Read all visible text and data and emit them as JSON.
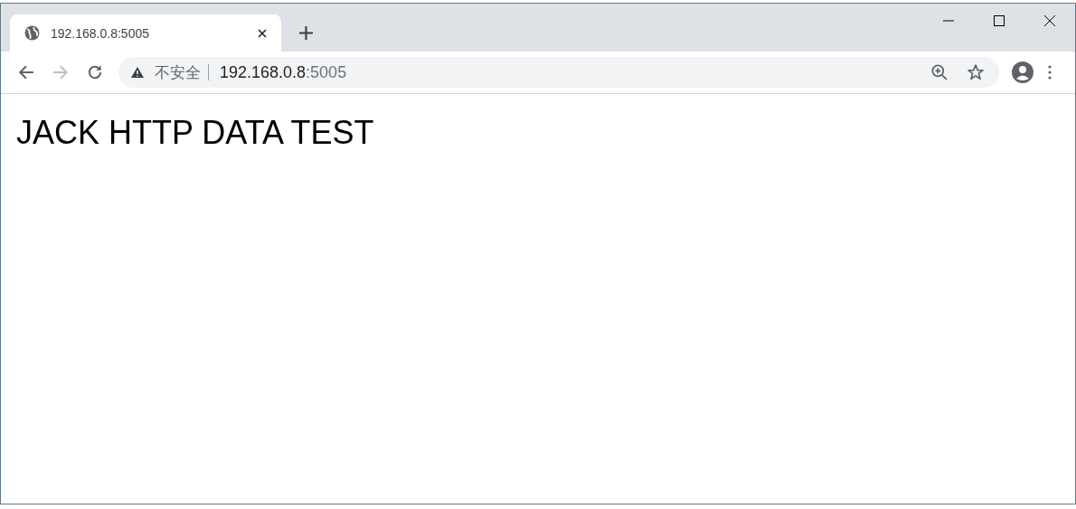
{
  "tabs": [
    {
      "title": "192.168.0.8:5005",
      "selected": true
    }
  ],
  "toolbar": {
    "back_disabled": false,
    "forward_disabled": true
  },
  "address_bar": {
    "security_label": "不安全",
    "host": "192.168.0.8",
    "port": ":5005"
  },
  "page": {
    "heading": "JACK HTTP DATA TEST"
  }
}
